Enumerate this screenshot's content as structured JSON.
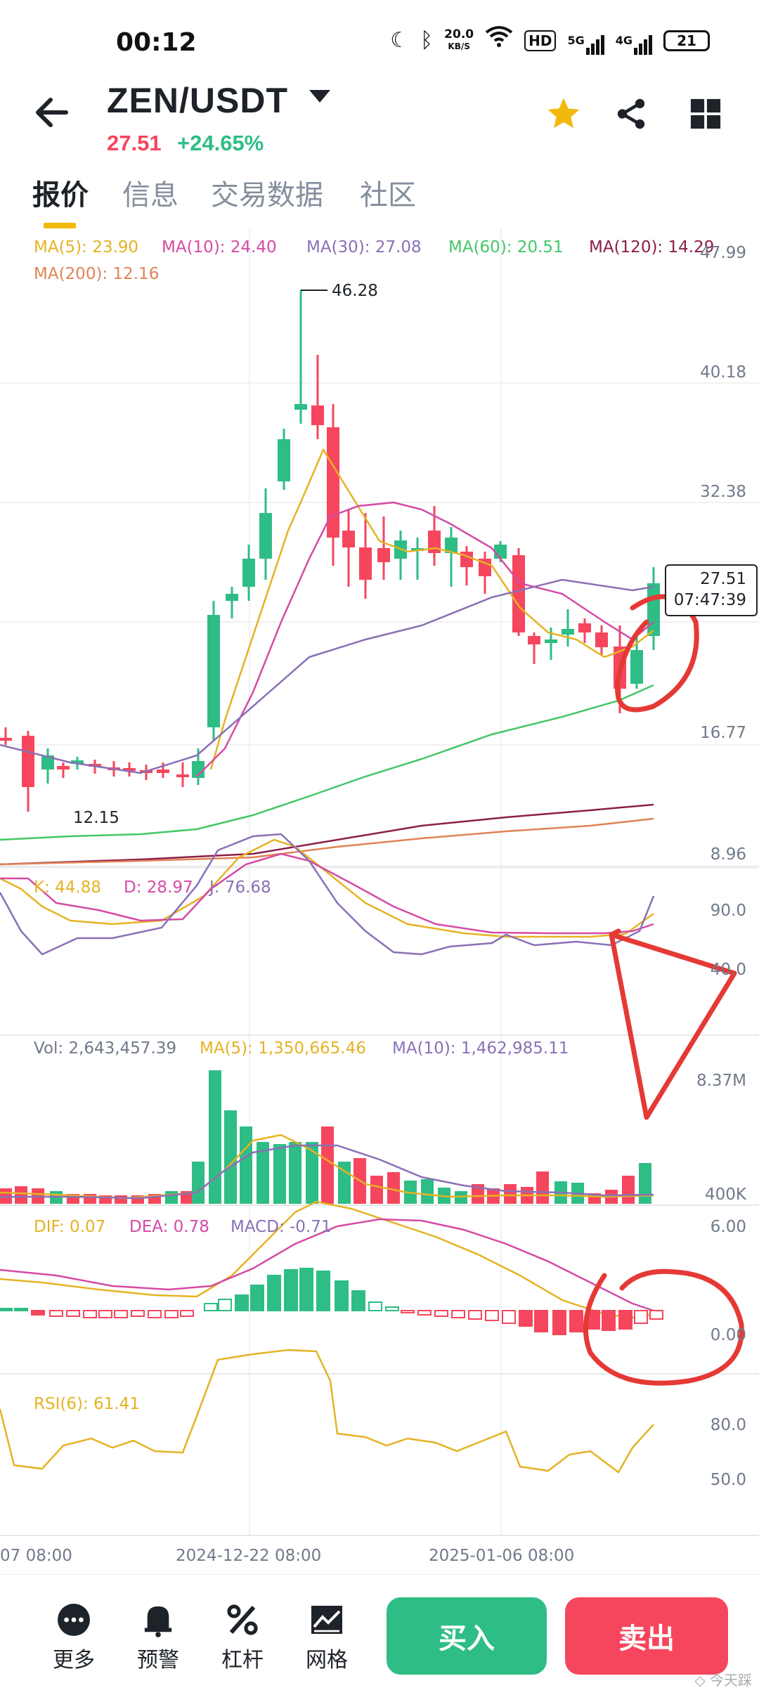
{
  "status_bar": {
    "time": "00:12",
    "net_speed_top": "20.0",
    "net_speed_unit": "KB/S",
    "hd": "HD",
    "sig1": "5G",
    "sig2": "4G",
    "battery": "21"
  },
  "header": {
    "pair": "ZEN/USDT",
    "price": "27.51",
    "change": "+24.65%"
  },
  "tabs": [
    "报价",
    "信息",
    "交易数据",
    "社区"
  ],
  "ma_legend": {
    "ma5": "MA(5): 23.90",
    "ma10": "MA(10): 24.40",
    "ma30": "MA(30): 27.08",
    "ma60": "MA(60): 20.51",
    "ma120": "MA(120): 14.29",
    "ma200": "MA(200): 12.16"
  },
  "price_axis": [
    "47.99",
    "40.18",
    "32.38",
    "",
    "16.77",
    "8.96"
  ],
  "price_labels": {
    "high": "46.28",
    "low": "12.15",
    "last_price": "27.51",
    "countdown": "07:47:39"
  },
  "kdj_legend": {
    "k": "K: 44.88",
    "d": "D: 28.97",
    "j": "J: 76.68"
  },
  "kdj_axis": [
    "90.0",
    "40.0"
  ],
  "vol_legend": {
    "vol": "Vol: 2,643,457.39",
    "ma5": "MA(5): 1,350,665.46",
    "ma10": "MA(10): 1,462,985.11"
  },
  "vol_axis": [
    "8.37M",
    "400K"
  ],
  "macd_legend": {
    "dif": "DIF: 0.07",
    "dea": "DEA: 0.78",
    "macd": "MACD: -0.71"
  },
  "macd_axis": [
    "6.00",
    "0.00"
  ],
  "rsi_legend": {
    "rsi": "RSI(6): 61.41"
  },
  "rsi_axis": [
    "80.0",
    "50.0"
  ],
  "time_axis": [
    "07 08:00",
    "2024-12-22 08:00",
    "2025-01-06 08:00"
  ],
  "colors": {
    "up": "#2ebd85",
    "down": "#f6465d",
    "ma5": "#e5b323",
    "ma10": "#d54aa5",
    "ma30": "#8a70b6",
    "ma60": "#44c767",
    "ma120": "#8b1e4a",
    "ma200": "#e08356",
    "accent": "#f0b90b"
  },
  "bottom_nav": [
    {
      "label": "更多",
      "icon": "more-icon"
    },
    {
      "label": "预警",
      "icon": "bell-icon"
    },
    {
      "label": "杠杆",
      "icon": "leverage-icon"
    },
    {
      "label": "网格",
      "icon": "grid-icon"
    }
  ],
  "buttons": {
    "buy": "买入",
    "sell": "卖出"
  },
  "watermark": "◇ 今天踩"
}
